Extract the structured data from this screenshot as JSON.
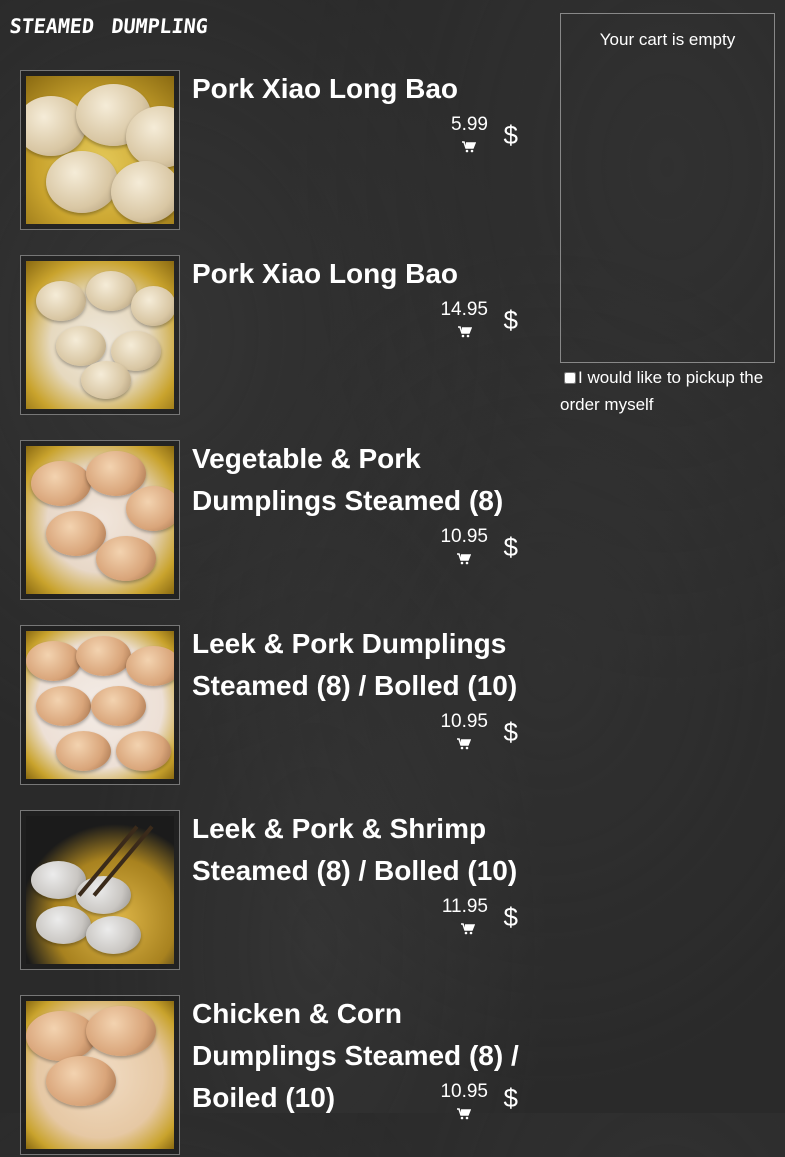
{
  "section_title": "steamed dumpling",
  "currency_symbol": "$",
  "items": [
    {
      "name": "Pork Xiao Long Bao",
      "price": "5.99"
    },
    {
      "name": "Pork Xiao Long Bao",
      "price": "14.95"
    },
    {
      "name": "Vegetable & Pork Dumplings Steamed (8)",
      "price": "10.95"
    },
    {
      "name": "Leek & Pork Dumplings Steamed (8) / Bolled (10)",
      "price": "10.95"
    },
    {
      "name": "Leek & Pork & Shrimp Steamed (8) / Bolled (10)",
      "price": "11.95"
    },
    {
      "name": "Chicken & Corn Dumplings Steamed (8) / Boiled (10)",
      "price": "10.95"
    }
  ],
  "cart": {
    "empty_message": "Your cart is empty",
    "pickup_label": "I would like to pickup the order myself",
    "pickup_checked": false
  },
  "icons": {
    "cart": "shopping-cart-icon"
  }
}
